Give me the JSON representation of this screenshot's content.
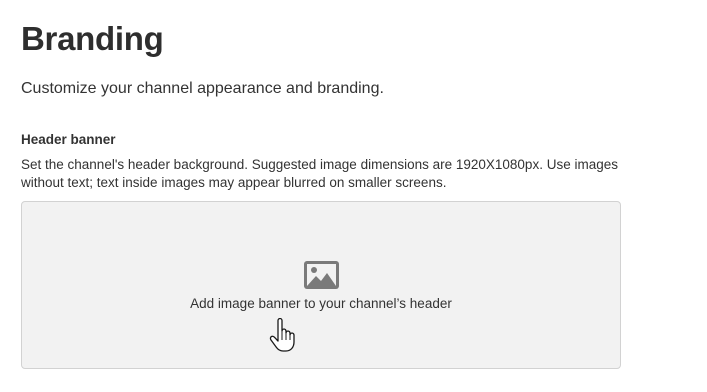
{
  "page": {
    "title": "Branding",
    "subtitle": "Customize your channel appearance and branding."
  },
  "header_banner": {
    "label": "Header banner",
    "description": "Set the channel's header background. Suggested image dimensions are 1920X1080px. Use images without text; text inside images may appear blurred on smaller screens.",
    "dropzone_label": "Add image banner to your channel’s header",
    "icon": "image-icon"
  },
  "pointer": {
    "icon": "hand-cursor-icon"
  },
  "colors": {
    "dropzone_bg": "#f2f2f2",
    "dropzone_border": "#d2d2d2",
    "icon_gray": "#7a7a7a",
    "text": "#333333"
  }
}
